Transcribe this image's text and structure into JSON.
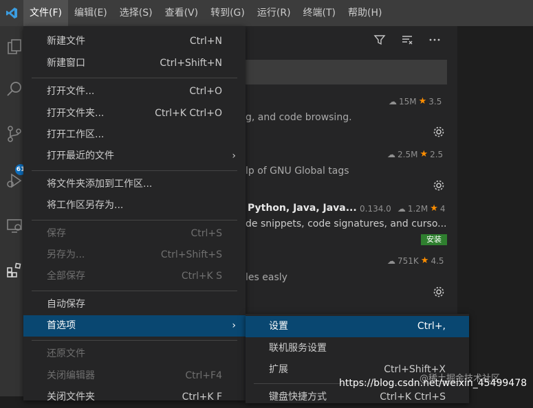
{
  "menubar": [
    "文件(F)",
    "编辑(E)",
    "选择(S)",
    "查看(V)",
    "转到(G)",
    "运行(R)",
    "终端(T)",
    "帮助(H)"
  ],
  "activity_badge": "61",
  "file_menu": {
    "items": [
      {
        "label": "新建文件",
        "shortcut": "Ctrl+N"
      },
      {
        "label": "新建窗口",
        "shortcut": "Ctrl+Shift+N"
      },
      {
        "label": "打开文件...",
        "shortcut": "Ctrl+O"
      },
      {
        "label": "打开文件夹...",
        "shortcut": "Ctrl+K Ctrl+O"
      },
      {
        "label": "打开工作区..."
      },
      {
        "label": "打开最近的文件"
      },
      {
        "label": "将文件夹添加到工作区..."
      },
      {
        "label": "将工作区另存为..."
      },
      {
        "label": "保存",
        "shortcut": "Ctrl+S"
      },
      {
        "label": "另存为...",
        "shortcut": "Ctrl+Shift+S"
      },
      {
        "label": "全部保存",
        "shortcut": "Ctrl+K S"
      },
      {
        "label": "自动保存"
      },
      {
        "label": "首选项"
      },
      {
        "label": "还原文件"
      },
      {
        "label": "关闭编辑器",
        "shortcut": "Ctrl+F4"
      },
      {
        "label": "关闭文件夹",
        "shortcut": "Ctrl+K F"
      }
    ]
  },
  "submenu": {
    "items": [
      {
        "label": "设置",
        "shortcut": "Ctrl+,"
      },
      {
        "label": "联机服务设置"
      },
      {
        "label": "扩展",
        "shortcut": "Ctrl+Shift+X"
      },
      {
        "label": "键盘快捷方式",
        "shortcut": "Ctrl+K Ctrl+S"
      }
    ]
  },
  "extensions": [
    {
      "downloads": "15M",
      "rating": "3.5",
      "desc": "g, and code browsing."
    },
    {
      "downloads": "2.5M",
      "rating": "2.5",
      "desc": "lp of GNU Global tags"
    },
    {
      "title": "Python, Java, Java...",
      "version": "0.134.0",
      "downloads": "1.2M",
      "rating": "4",
      "desc": "de snippets, code signatures, and curso...",
      "install": "安装"
    },
    {
      "downloads": "751K",
      "rating": "4.5",
      "desc": "les easly"
    }
  ],
  "watermark": {
    "url": "https://blog.csdn.net/weixin_45499478",
    "site": "@稀土掘金技术社区"
  }
}
